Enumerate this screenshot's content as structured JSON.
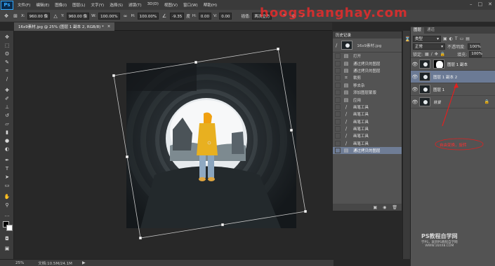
{
  "app": {
    "logo": "Ps"
  },
  "menu": [
    "文件(F)",
    "编辑(E)",
    "图像(I)",
    "图层(L)",
    "文字(Y)",
    "选择(S)",
    "滤镜(T)",
    "3D(D)",
    "视图(V)",
    "窗口(W)",
    "帮助(H)"
  ],
  "options": {
    "x_label": "X:",
    "x_value": "960.00 像",
    "y_label": "Y:",
    "y_value": "960.00 像",
    "w_label": "W:",
    "w_value": "100.00%",
    "h_label": "H:",
    "h_value": "100.00%",
    "angle_value": "-9.35",
    "h2_label": "H:",
    "h2_value": "0.00",
    "v_label": "V:",
    "v_value": "0.00",
    "interp_label": "插值:",
    "interp_value": "两次立方"
  },
  "watermark_top": "hoogshanghay.com",
  "document": {
    "tab_title": "16x9素材.jpg @ 25% (图层 1 副本 2, RGB/8) *",
    "close": "×"
  },
  "history": {
    "header": "历史记录",
    "snapshot": "16x9素材.jpg",
    "items": [
      {
        "label": "打开",
        "icon": "▤"
      },
      {
        "label": "通过拷贝的图层",
        "icon": "▤"
      },
      {
        "label": "通过拷贝的图层",
        "icon": "▤"
      },
      {
        "label": "裁剪",
        "icon": "⌗"
      },
      {
        "label": "移去杂",
        "icon": "▤"
      },
      {
        "label": "添加图层蒙版",
        "icon": "▤"
      },
      {
        "label": "应用",
        "icon": "▤"
      },
      {
        "label": "画笔工具",
        "icon": "∕"
      },
      {
        "label": "画笔工具",
        "icon": "∕"
      },
      {
        "label": "画笔工具",
        "icon": "∕"
      },
      {
        "label": "画笔工具",
        "icon": "∕"
      },
      {
        "label": "画笔工具",
        "icon": "∕"
      },
      {
        "label": "画笔工具",
        "icon": "∕"
      },
      {
        "label": "通过拷贝的图层",
        "icon": "▤"
      }
    ],
    "active_index": 13
  },
  "layers_panel": {
    "tabs": [
      "图层",
      "通道"
    ],
    "kind_label": "类型",
    "blend_mode": "正常",
    "opacity_label": "不透明度:",
    "opacity_value": "100%",
    "lock_label": "锁定:",
    "fill_label": "填充:",
    "fill_value": "100%",
    "layers": [
      {
        "name": "图层 1 副本",
        "has_mask": true,
        "selected": false,
        "locked": false
      },
      {
        "name": "图层 1 副本 2",
        "has_mask": false,
        "selected": true,
        "locked": false
      },
      {
        "name": "图层 1",
        "has_mask": false,
        "selected": false,
        "locked": false
      },
      {
        "name": "背景",
        "has_mask": false,
        "selected": false,
        "locked": true
      }
    ]
  },
  "annotation": {
    "text": "自由变换，旋转"
  },
  "status": {
    "zoom": "25%",
    "doc_info": "文档:10.5M/24.1M"
  },
  "watermark_bottom": {
    "line1": "PS教程自学网",
    "line2": "学PS，就到PS教程自学网",
    "line3": "WWW.16XX8.COM"
  },
  "colors": {
    "accent_selected": "#6b7a95",
    "watermark_red": "#ff2828",
    "coat_yellow": "#e8b020"
  }
}
